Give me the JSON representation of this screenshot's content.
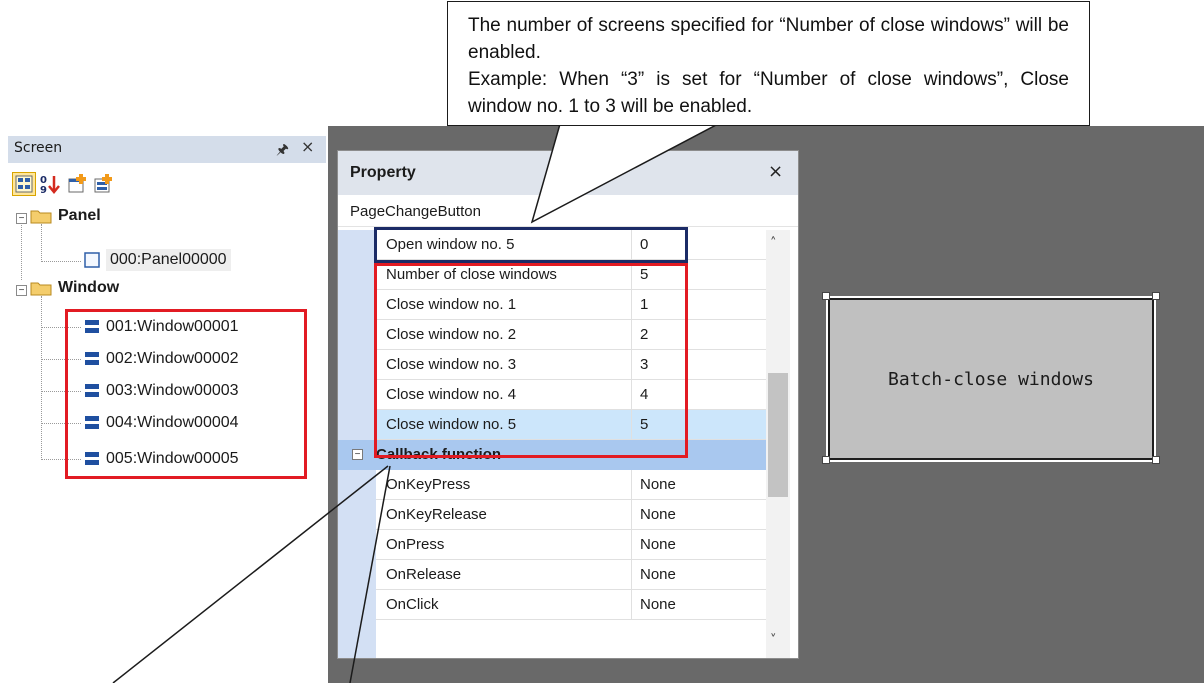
{
  "screen_panel": {
    "title": "Screen",
    "pin_icon": "pin-icon",
    "close_icon": "close-icon",
    "toolbar_icons": [
      "screen-list-icon",
      "sort-number-icon",
      "add-panel-icon",
      "add-window-icon"
    ],
    "tree": {
      "panel_folder": "Panel",
      "panel_items": [
        "000:Panel00000"
      ],
      "window_folder": "Window",
      "window_items": [
        "001:Window00001",
        "002:Window00002",
        "003:Window00003",
        "004:Window00004",
        "005:Window00005"
      ]
    }
  },
  "property": {
    "title": "Property",
    "object_name": "PageChangeButton",
    "rows": [
      {
        "name": "Open window no. 5",
        "value": "0"
      },
      {
        "name": "Number of close windows",
        "value": "5"
      },
      {
        "name": "Close window no. 1",
        "value": "1"
      },
      {
        "name": "Close window no. 2",
        "value": "2"
      },
      {
        "name": "Close window no. 3",
        "value": "3"
      },
      {
        "name": "Close window no. 4",
        "value": "4"
      },
      {
        "name": "Close window no. 5",
        "value": "5"
      }
    ],
    "category": "Callback function",
    "callback_rows": [
      {
        "name": "OnKeyPress",
        "value": "None"
      },
      {
        "name": "OnKeyRelease",
        "value": "None"
      },
      {
        "name": "OnPress",
        "value": "None"
      },
      {
        "name": "OnRelease",
        "value": "None"
      },
      {
        "name": "OnClick",
        "value": "None"
      }
    ]
  },
  "canvas": {
    "button_label": "Batch-close windows",
    "background_color": "#696969",
    "button_color": "#c0c0c0"
  },
  "callout": {
    "line1": "The number of screens specified for “Number of close windows” will be enabled.",
    "line2": "Example: When “3” is set for “Number of close windows”, Close window no. 1 to 3 will be enabled."
  },
  "highlight_colors": {
    "red": "#e21b23",
    "navy": "#1b2b66"
  }
}
